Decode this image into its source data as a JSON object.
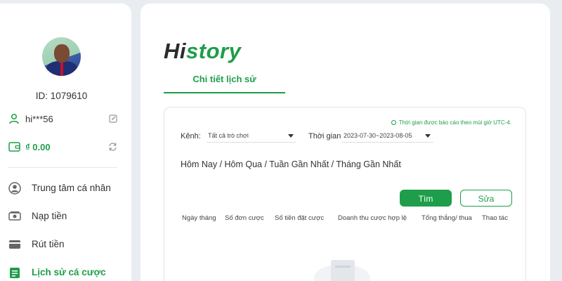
{
  "sidebar": {
    "user_id": "ID: 1079610",
    "username": "hi***56",
    "balance": "₫ 0.00",
    "menu": [
      {
        "label": "Trung tâm cá nhân",
        "icon": "user-circle-icon",
        "active": false
      },
      {
        "label": "Nạp tiền",
        "icon": "deposit-icon",
        "active": false
      },
      {
        "label": "Rút tiền",
        "icon": "card-icon",
        "active": false
      },
      {
        "label": "Lịch sử cá cược",
        "icon": "history-list-icon",
        "active": true
      }
    ]
  },
  "main": {
    "title_part1": "Hi",
    "title_part2": "story",
    "tab": "Chi tiết lịch sử",
    "timezone_note": "Thời gian được báo cáo theo múi giờ UTC-4.",
    "filters": {
      "channel_label": "Kênh:",
      "channel_value": "Tất cả trò chơi",
      "time_label": "Thời gian",
      "time_value": "2023-07-30~2023-08-05"
    },
    "quick_ranges": "Hôm Nay / Hôm Qua / Tuần Gần Nhất / Tháng Gần Nhất",
    "buttons": {
      "search": "Tìm",
      "edit": "Sửa"
    },
    "table_headers": [
      "Ngày tháng",
      "Số đơn cược",
      "Số tiền đặt cược",
      "Doanh thu cược hợp lệ",
      "Tổng thắng/ thua",
      "Thao tác"
    ]
  },
  "colors": {
    "accent": "#1e9e4a",
    "background": "#e9edf2",
    "text": "#333333"
  }
}
